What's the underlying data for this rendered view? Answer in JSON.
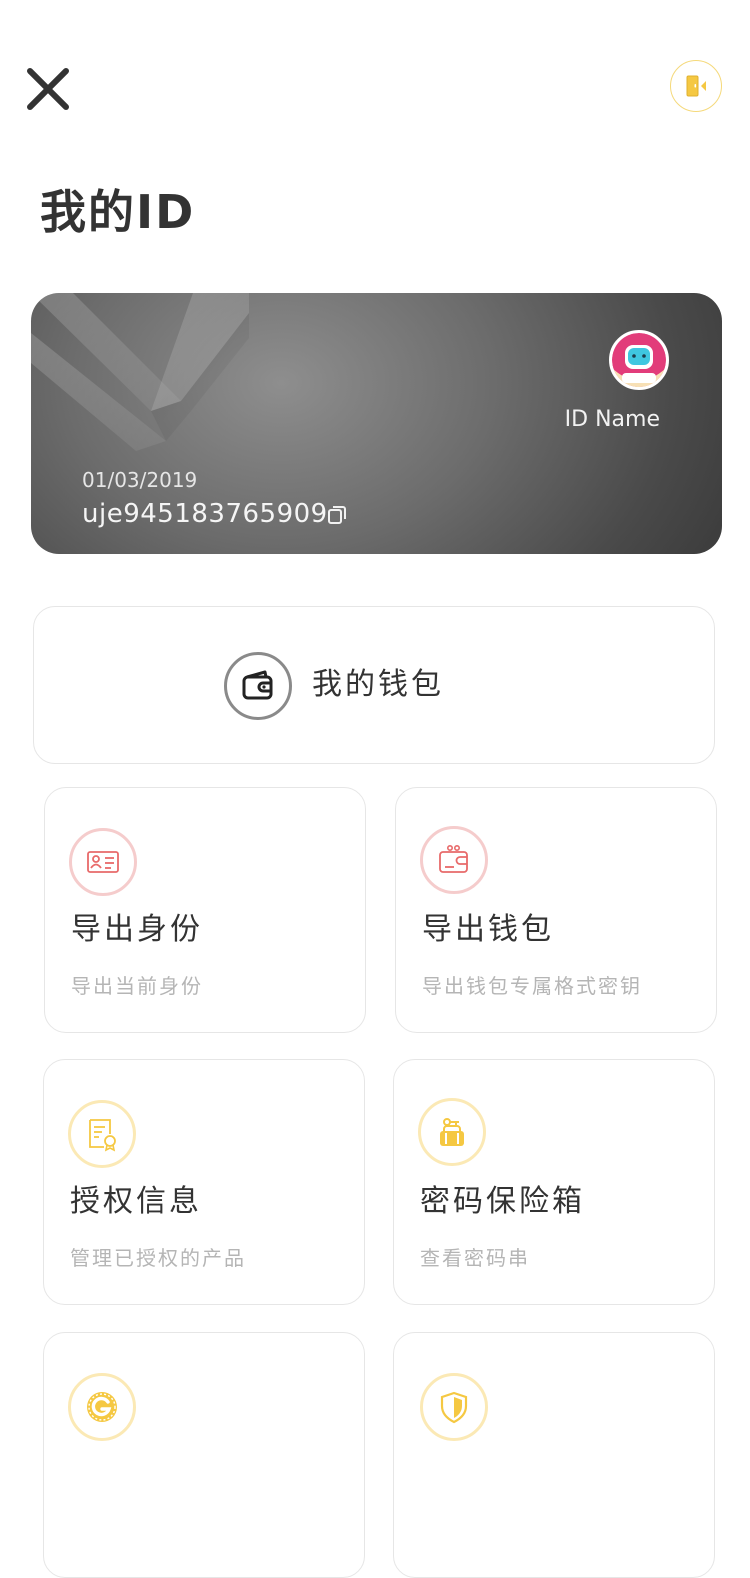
{
  "header": {
    "close_icon": "close-icon",
    "logout_icon": "door-exit-icon",
    "accent_color": "#f5c842"
  },
  "page": {
    "title": "我的ID"
  },
  "id_card": {
    "name": "ID Name",
    "date": "01/03/2019",
    "number": "uje945183765909",
    "avatar_icon": "astronaut-avatar",
    "copy_icon": "copy-icon"
  },
  "wallet": {
    "label": "我的钱包",
    "icon": "wallet-icon"
  },
  "tiles": [
    {
      "title": "导出身份",
      "subtitle": "导出当前身份",
      "icon": "id-card-icon",
      "accent": "#e86a6a"
    },
    {
      "title": "导出钱包",
      "subtitle": "导出钱包专属格式密钥",
      "icon": "wallet-export-icon",
      "accent": "#e86a6a"
    },
    {
      "title": "授权信息",
      "subtitle": "管理已授权的产品",
      "icon": "certificate-icon",
      "accent": "#f5c842"
    },
    {
      "title": "密码保险箱",
      "subtitle": "查看密码串",
      "icon": "key-lock-icon",
      "accent": "#f5c842"
    },
    {
      "title": "",
      "subtitle": "",
      "icon": "g-coin-icon",
      "accent": "#f5c842"
    },
    {
      "title": "",
      "subtitle": "",
      "icon": "shield-icon",
      "accent": "#f5c842"
    }
  ]
}
